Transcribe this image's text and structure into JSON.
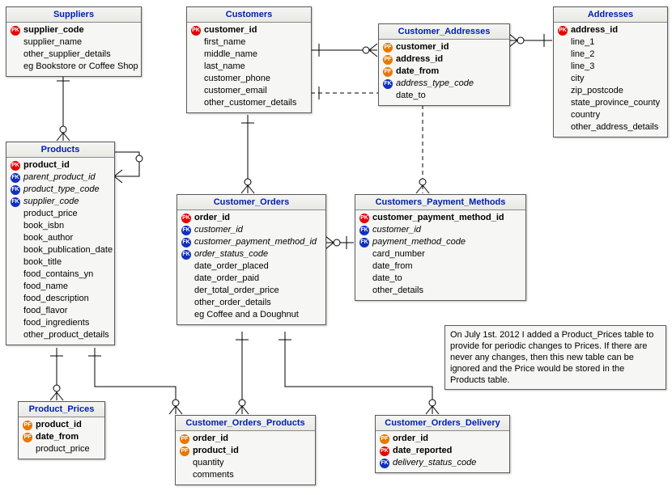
{
  "entities": {
    "suppliers": {
      "title": "Suppliers",
      "fields": [
        {
          "key": "pk",
          "text": "supplier_code",
          "bold": true
        },
        {
          "key": "",
          "text": "supplier_name"
        },
        {
          "key": "",
          "text": "other_supplier_details"
        },
        {
          "key": "",
          "text": "eg Bookstore or Coffee Shop"
        }
      ]
    },
    "products": {
      "title": "Products",
      "fields": [
        {
          "key": "pk",
          "text": "product_id",
          "bold": true
        },
        {
          "key": "fk",
          "text": "parent_product_id",
          "italic": true
        },
        {
          "key": "fk",
          "text": "product_type_code",
          "italic": true
        },
        {
          "key": "fk",
          "text": "supplier_code",
          "italic": true
        },
        {
          "key": "",
          "text": "product_price"
        },
        {
          "key": "",
          "text": "book_isbn"
        },
        {
          "key": "",
          "text": "book_author"
        },
        {
          "key": "",
          "text": "book_publication_date"
        },
        {
          "key": "",
          "text": "book_title"
        },
        {
          "key": "",
          "text": "food_contains_yn"
        },
        {
          "key": "",
          "text": "food_name"
        },
        {
          "key": "",
          "text": "food_description"
        },
        {
          "key": "",
          "text": "food_flavor"
        },
        {
          "key": "",
          "text": "food_ingredients"
        },
        {
          "key": "",
          "text": "other_product_details"
        }
      ]
    },
    "customers": {
      "title": "Customers",
      "fields": [
        {
          "key": "pk",
          "text": "customer_id",
          "bold": true
        },
        {
          "key": "",
          "text": "first_name"
        },
        {
          "key": "",
          "text": "middle_name"
        },
        {
          "key": "",
          "text": "last_name"
        },
        {
          "key": "",
          "text": "customer_phone"
        },
        {
          "key": "",
          "text": "customer_email"
        },
        {
          "key": "",
          "text": "other_customer_details"
        }
      ]
    },
    "customer_addresses": {
      "title": "Customer_Addresses",
      "fields": [
        {
          "key": "pf",
          "text": "customer_id",
          "bold": true
        },
        {
          "key": "pf",
          "text": "address_id",
          "bold": true
        },
        {
          "key": "pf",
          "text": "date_from",
          "bold": true
        },
        {
          "key": "fk",
          "text": "address_type_code",
          "italic": true
        },
        {
          "key": "",
          "text": "date_to"
        }
      ]
    },
    "addresses": {
      "title": "Addresses",
      "fields": [
        {
          "key": "pk",
          "text": "address_id",
          "bold": true
        },
        {
          "key": "",
          "text": "line_1"
        },
        {
          "key": "",
          "text": "line_2"
        },
        {
          "key": "",
          "text": "line_3"
        },
        {
          "key": "",
          "text": "city"
        },
        {
          "key": "",
          "text": "zip_postcode"
        },
        {
          "key": "",
          "text": "state_province_county"
        },
        {
          "key": "",
          "text": "country"
        },
        {
          "key": "",
          "text": "other_address_details"
        }
      ]
    },
    "customer_orders": {
      "title": "Customer_Orders",
      "fields": [
        {
          "key": "pk",
          "text": "order_id",
          "bold": true
        },
        {
          "key": "fk",
          "text": "customer_id",
          "italic": true
        },
        {
          "key": "fk",
          "text": "customer_payment_method_id",
          "italic": true
        },
        {
          "key": "fk",
          "text": "order_status_code",
          "italic": true
        },
        {
          "key": "",
          "text": "date_order_placed"
        },
        {
          "key": "",
          "text": "date_order_paid"
        },
        {
          "key": "",
          "text": "der_total_order_price"
        },
        {
          "key": "",
          "text": "other_order_details"
        },
        {
          "key": "",
          "text": "eg Coffee and a Doughnut"
        }
      ]
    },
    "payment_methods": {
      "title": "Customers_Payment_Methods",
      "fields": [
        {
          "key": "pk",
          "text": "customer_payment_method_id",
          "bold": true
        },
        {
          "key": "fk",
          "text": "customer_id",
          "italic": true
        },
        {
          "key": "fk",
          "text": "payment_method_code",
          "italic": true
        },
        {
          "key": "",
          "text": "card_number"
        },
        {
          "key": "",
          "text": "date_from"
        },
        {
          "key": "",
          "text": "date_to"
        },
        {
          "key": "",
          "text": "other_details"
        }
      ]
    },
    "product_prices": {
      "title": "Product_Prices",
      "fields": [
        {
          "key": "pf",
          "text": "product_id",
          "bold": true
        },
        {
          "key": "pf",
          "text": "date_from",
          "bold": true
        },
        {
          "key": "",
          "text": "product_price"
        }
      ]
    },
    "orders_products": {
      "title": "Customer_Orders_Products",
      "fields": [
        {
          "key": "pf",
          "text": "order_id",
          "bold": true
        },
        {
          "key": "pf",
          "text": "product_id",
          "bold": true
        },
        {
          "key": "",
          "text": "quantity"
        },
        {
          "key": "",
          "text": "comments"
        }
      ]
    },
    "orders_delivery": {
      "title": "Customer_Orders_Delivery",
      "fields": [
        {
          "key": "pf",
          "text": "order_id",
          "bold": true
        },
        {
          "key": "pk",
          "text": "date_reported",
          "bold": true
        },
        {
          "key": "fk",
          "text": "delivery_status_code",
          "italic": true
        }
      ]
    }
  },
  "note": "On July 1st. 2012 I added a Product_Prices table to provide for periodic changes to Prices. If there are never any changes, then this new table can be ignored and the Price would be stored in the Products table.",
  "key_labels": {
    "pk": "PK",
    "pf": "PF",
    "fk": "FK"
  }
}
